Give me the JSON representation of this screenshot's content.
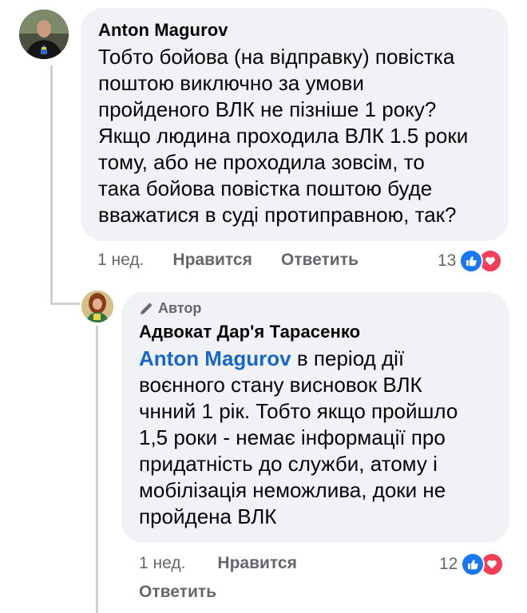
{
  "comment": {
    "author": "Anton Magurov",
    "text": "Тобто бойова (на відправку) повістка\nпоштою виключно за умови\nпройденого ВЛК не пізніше 1 року?\nЯкщо людина проходила ВЛК 1.5 роки\nтому, або не проходила зовсім, то\nтака бойова повістка поштою буде\nвважатися в суді протиправною, так?",
    "time": "1 нед.",
    "like_label": "Нравится",
    "reply_label": "Ответить",
    "reaction_count": "13"
  },
  "reply": {
    "badge": "Автор",
    "author": "Адвокат Дар'я Тарасенко",
    "mention": "Anton Magurov",
    "text": " в період дії\nвоєнного стану висновок ВЛК\nчнний 1 рік. Тобто якщо пройшло\n1,5 роки - немає інформації про\nпридатність до служби,  атому і\nмобілізація неможлива, доки не\nпройдена ВЛК",
    "time": "1 нед.",
    "like_label": "Нравится",
    "reply_label": "Ответить",
    "reaction_count": "12"
  },
  "icons": {
    "like": "like-reaction-icon",
    "love": "love-reaction-icon",
    "pencil": "pencil-icon"
  },
  "colors": {
    "bubble": "#f0f2f5",
    "mention": "#1766c9",
    "meta": "#65676b",
    "like": "#1877f2",
    "love": "#f33e58"
  }
}
